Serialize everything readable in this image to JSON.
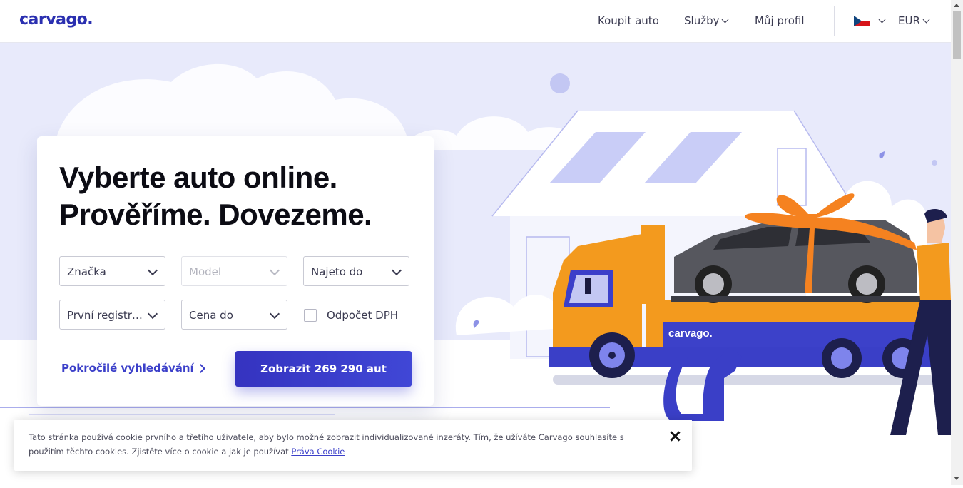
{
  "header": {
    "logo": "carvago.",
    "nav": [
      {
        "label": "Koupit auto"
      },
      {
        "label": "Služby"
      },
      {
        "label": "Můj profil"
      }
    ],
    "currency": "EUR"
  },
  "hero": {
    "headline_line1": "Vyberte auto online.",
    "headline_line2": "Prověříme. Dovezeme.",
    "filters": {
      "brand": "Značka",
      "model": "Model",
      "mileage": "Najeto do",
      "first_registration": "První registrace",
      "price": "Cena do"
    },
    "vat_checkbox_label": "Odpočet DPH",
    "advanced_search": "Pokročilé vyhledávání",
    "cta": "Zobrazit 269 290 aut",
    "truck_brand": "carvago."
  },
  "cookie": {
    "text": "Tato stránka používá cookie prvního a třetího uživatele, aby bylo možné zobrazit individualizované inzeráty. Tím, že užíváte Carvago souhlasíte s použitím těchto cookies. Zjistěte více o cookie a jak je používat",
    "link": "Práva Cookie"
  },
  "colors": {
    "brand": "#2a2fb0",
    "cta": "#3b3fc9",
    "accent_orange": "#f08a1c",
    "hero_bg": "#e8eafb"
  }
}
